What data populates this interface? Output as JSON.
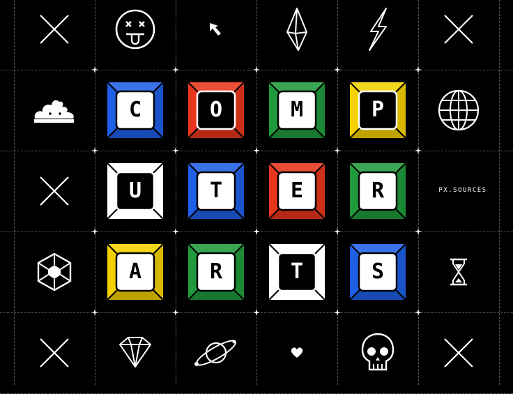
{
  "brand": "PX.SOURCES",
  "tiles": [
    {
      "letter": "C",
      "color": "#1f5fe6",
      "inverted": false
    },
    {
      "letter": "O",
      "color": "#e8361c",
      "inverted": true
    },
    {
      "letter": "M",
      "color": "#1f9a3c",
      "inverted": false
    },
    {
      "letter": "P",
      "color": "#f4d000",
      "inverted": true
    },
    {
      "letter": "U",
      "color": "#ffffff",
      "inverted": true
    },
    {
      "letter": "T",
      "color": "#1f5fe6",
      "inverted": false
    },
    {
      "letter": "E",
      "color": "#e8361c",
      "inverted": false
    },
    {
      "letter": "R",
      "color": "#1f9a3c",
      "inverted": false
    },
    {
      "letter": "A",
      "color": "#f4d000",
      "inverted": false
    },
    {
      "letter": "R",
      "color": "#1f9a3c",
      "inverted": false
    },
    {
      "letter": "T",
      "color": "#ffffff",
      "inverted": true
    },
    {
      "letter": "S",
      "color": "#1f5fe6",
      "inverted": false
    }
  ],
  "icons": [
    "x-mark-icon",
    "dizzy-face-icon",
    "cursor-arrow-icon",
    "crystal-icon",
    "lightning-icon",
    "x-mark-icon",
    "poop-icon",
    "globe-icon",
    "x-mark-icon",
    "cube-icon",
    "hourglass-icon",
    "x-mark-icon",
    "diamond-icon",
    "planet-icon",
    "heart-icon",
    "skull-icon",
    "x-mark-icon"
  ]
}
